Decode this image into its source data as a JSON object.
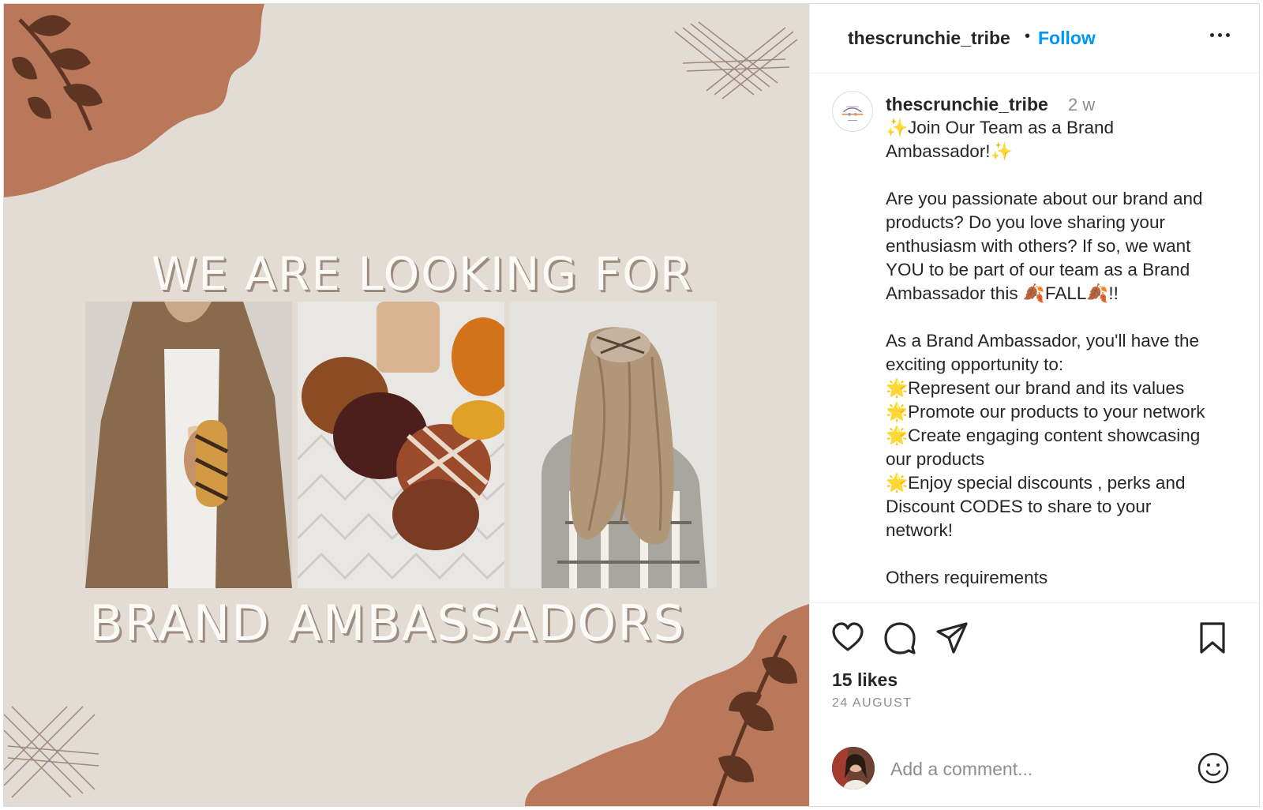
{
  "media": {
    "headline_top": "WE ARE LOOKING FOR",
    "headline_bottom": "BRAND AMBASSADORS"
  },
  "header": {
    "username": "thescrunchie_tribe",
    "separator": "•",
    "follow_label": "Follow"
  },
  "caption": {
    "username": "thescrunchie_tribe",
    "time": "2 w",
    "text": "✨Join Our Team as a Brand\nAmbassador!✨\n\nAre you passionate about our brand and\nproducts? Do you love sharing your\nenthusiasm with others? If so, we want\nYOU to be part of our team as a Brand\nAmbassador this 🍂FALL🍂!!\n\nAs a Brand Ambassador, you'll have the\nexciting opportunity to:\n🌟Represent our brand and its values\n🌟Promote our products to your network\n🌟Create engaging content showcasing\nour products\n🌟Enjoy special discounts , perks and\nDiscount CODES to share to your\nnetwork!\n\nOthers requirements"
  },
  "actions": {
    "likes": "15 likes",
    "date": "24 AUGUST"
  },
  "comment": {
    "placeholder": "Add a comment..."
  },
  "colors": {
    "follow": "#0095f6",
    "media_bg": "#e3dcd5",
    "splash": "#b97859"
  }
}
